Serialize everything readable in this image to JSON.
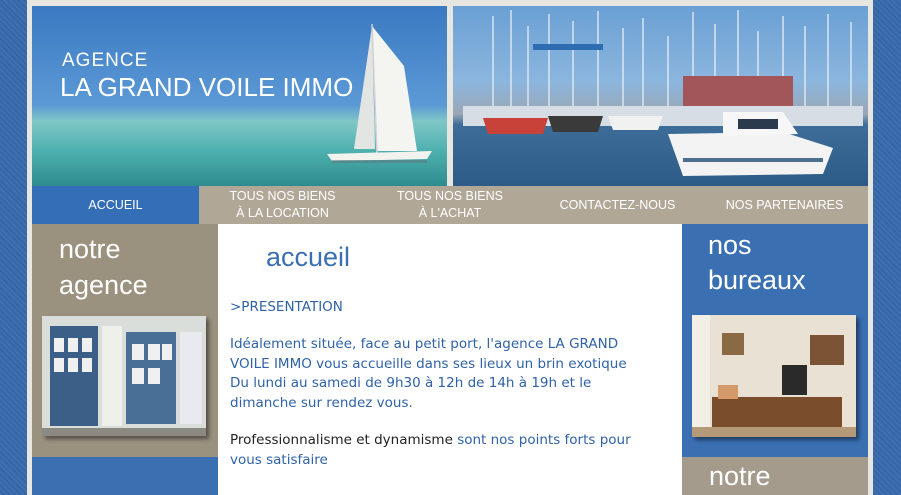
{
  "header": {
    "brand_sub": "AGENCE",
    "brand_main": "LA GRAND VOILE IMMO",
    "left_image": "sailboat-catamaran-image",
    "right_image": "marina-boats-image"
  },
  "nav": {
    "items": [
      {
        "label": "ACCUEIL"
      },
      {
        "label": "TOUS NOS BIENS\nÀ LA LOCATION"
      },
      {
        "label": "TOUS NOS BIENS\nÀ L'ACHAT"
      },
      {
        "label": "CONTACTEZ-NOUS"
      },
      {
        "label": "NOS PARTENAIRES"
      }
    ]
  },
  "left": {
    "heading_line1": "notre",
    "heading_line2": "agence"
  },
  "main": {
    "title": "accueil",
    "presentation_link": ">PRESENTATION",
    "para1": "Idéalement située, face au petit port, l'agence LA GRAND VOILE IMMO vous accueille dans ses lieux un brin exotique",
    "para2": "Du lundi au samedi de 9h30 à 12h de 14h à 19h et le dimanche sur rendez vous.",
    "para3_dark": "Professionnalisme et dynamisme",
    "para3_blue": "sont nos points forts pour vous satisfaire"
  },
  "right": {
    "heading_line1": "nos",
    "heading_line2": "bureaux",
    "bottom_heading": "notre"
  },
  "colors": {
    "accent_blue": "#346eb6",
    "taupe": "#9b917f",
    "text_blue": "#2f62a8"
  }
}
